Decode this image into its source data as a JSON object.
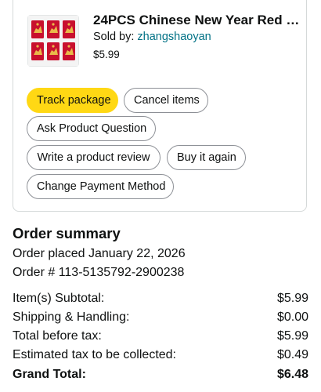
{
  "product": {
    "title": "24PCS Chinese New Year Red E...",
    "sold_by_label": "Sold by: ",
    "seller": "zhangshaoyan",
    "price": "$5.99",
    "image": "red-envelopes-thumbnail"
  },
  "actions": {
    "track_package": "Track package",
    "cancel_items": "Cancel items",
    "ask_question": "Ask Product Question",
    "write_review": "Write a product review",
    "buy_again": "Buy it again",
    "change_payment": "Change Payment Method"
  },
  "order_summary": {
    "title": "Order summary",
    "placed": "Order placed January 22, 2026",
    "order_number": "Order # 113-5135792-2900238",
    "rows": [
      {
        "label": "Item(s) Subtotal:",
        "value": "$5.99"
      },
      {
        "label": "Shipping & Handling:",
        "value": "$0.00"
      },
      {
        "label": "Total before tax:",
        "value": "$5.99"
      },
      {
        "label": "Estimated tax to be collected:",
        "value": "$0.49"
      },
      {
        "label": "Grand Total:",
        "value": "$6.48"
      }
    ]
  },
  "colors": {
    "primary_button": "#ffd814",
    "link": "#007185",
    "envelope_red": "#c8102e",
    "envelope_gold": "#e9b949"
  }
}
